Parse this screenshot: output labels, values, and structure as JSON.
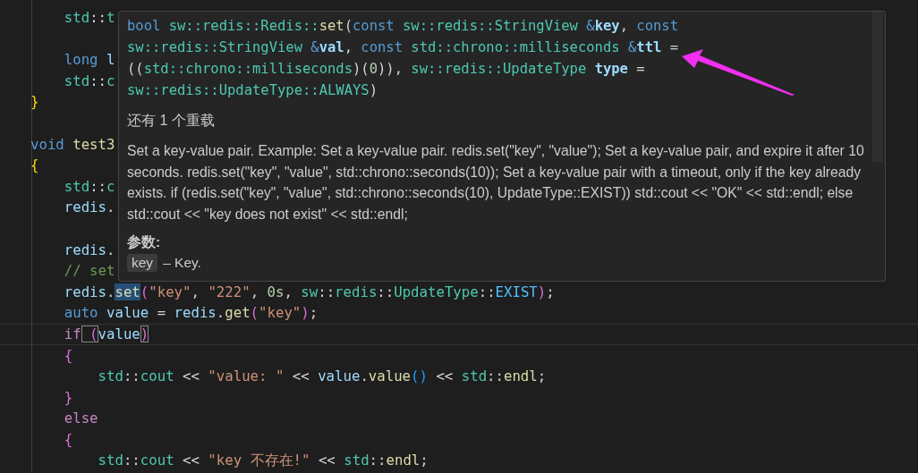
{
  "code_lines": [
    {
      "kind": "code",
      "tokens": [
        {
          "t": "    std",
          "kind": "type"
        },
        {
          "t": "::",
          "kind": "plain"
        },
        {
          "t": "t",
          "kind": "type"
        }
      ]
    },
    {
      "kind": "blank"
    },
    {
      "kind": "code",
      "tokens": [
        {
          "t": "    long",
          "kind": "kw"
        },
        {
          "t": " l",
          "kind": "var"
        }
      ]
    },
    {
      "kind": "code",
      "tokens": [
        {
          "t": "    std",
          "kind": "type"
        },
        {
          "t": "::",
          "kind": "plain"
        },
        {
          "t": "c",
          "kind": "type"
        }
      ]
    },
    {
      "kind": "code",
      "tokens": [
        {
          "t": "}",
          "kind": "brace1"
        }
      ]
    },
    {
      "kind": "blank"
    },
    {
      "kind": "code",
      "tokens": [
        {
          "t": "void",
          "kind": "kw"
        },
        {
          "t": " test3",
          "kind": "fn"
        }
      ]
    },
    {
      "kind": "code",
      "tokens": [
        {
          "t": "{",
          "kind": "brace1"
        }
      ]
    },
    {
      "kind": "code",
      "tokens": [
        {
          "t": "    std",
          "kind": "type"
        },
        {
          "t": "::",
          "kind": "plain"
        },
        {
          "t": "c",
          "kind": "type"
        }
      ]
    },
    {
      "kind": "code",
      "tokens": [
        {
          "t": "    redis",
          "kind": "var"
        },
        {
          "t": ".",
          "kind": "plain"
        }
      ]
    },
    {
      "kind": "blank"
    },
    {
      "kind": "code",
      "tokens": [
        {
          "t": "    redis",
          "kind": "var"
        },
        {
          "t": ".",
          "kind": "plain"
        }
      ]
    },
    {
      "kind": "code",
      "tokens": [
        {
          "t": "    // set",
          "kind": "comment"
        }
      ]
    },
    {
      "kind": "code",
      "tokens": [
        {
          "t": "    redis",
          "kind": "var"
        },
        {
          "t": ".",
          "kind": "plain"
        },
        {
          "t": "set",
          "kind": "fn",
          "highlighted": true
        },
        {
          "t": "(",
          "kind": "brace2"
        },
        {
          "t": "\"key\"",
          "kind": "str"
        },
        {
          "t": ",",
          "kind": "plain"
        },
        {
          "t": " \"222\"",
          "kind": "str"
        },
        {
          "t": ",",
          "kind": "plain"
        },
        {
          "t": " 0s",
          "kind": "num"
        },
        {
          "t": ",",
          "kind": "plain"
        },
        {
          "t": " sw",
          "kind": "type"
        },
        {
          "t": "::",
          "kind": "plain"
        },
        {
          "t": "redis",
          "kind": "type"
        },
        {
          "t": "::",
          "kind": "plain"
        },
        {
          "t": "UpdateType",
          "kind": "type"
        },
        {
          "t": "::",
          "kind": "plain"
        },
        {
          "t": "EXIST",
          "kind": "enum"
        },
        {
          "t": ")",
          "kind": "brace2"
        },
        {
          "t": ";",
          "kind": "plain"
        }
      ]
    },
    {
      "kind": "code",
      "tokens": [
        {
          "t": "    auto",
          "kind": "kw"
        },
        {
          "t": " value",
          "kind": "var"
        },
        {
          "t": " =",
          "kind": "plain"
        },
        {
          "t": " redis",
          "kind": "var"
        },
        {
          "t": ".",
          "kind": "plain"
        },
        {
          "t": "get",
          "kind": "fn"
        },
        {
          "t": "(",
          "kind": "brace2"
        },
        {
          "t": "\"key\"",
          "kind": "str"
        },
        {
          "t": ")",
          "kind": "brace2"
        },
        {
          "t": ";",
          "kind": "plain"
        }
      ]
    },
    {
      "kind": "code",
      "current": true,
      "tokens": [
        {
          "t": "    if",
          "kind": "ctrl"
        },
        {
          "t": " (",
          "kind": "brace2",
          "matched": true
        },
        {
          "t": "value",
          "kind": "var"
        },
        {
          "t": ")",
          "kind": "brace2",
          "matched": true
        }
      ]
    },
    {
      "kind": "code",
      "tokens": [
        {
          "t": "    {",
          "kind": "brace2"
        }
      ]
    },
    {
      "kind": "code",
      "tokens": [
        {
          "t": "        std",
          "kind": "type"
        },
        {
          "t": "::",
          "kind": "plain"
        },
        {
          "t": "cout",
          "kind": "type"
        },
        {
          "t": " <<",
          "kind": "plain"
        },
        {
          "t": " \"value: \"",
          "kind": "str"
        },
        {
          "t": " <<",
          "kind": "plain"
        },
        {
          "t": " value",
          "kind": "var"
        },
        {
          "t": ".",
          "kind": "plain"
        },
        {
          "t": "value",
          "kind": "fn"
        },
        {
          "t": "()",
          "kind": "brace3"
        },
        {
          "t": " <<",
          "kind": "plain"
        },
        {
          "t": " std",
          "kind": "type"
        },
        {
          "t": "::",
          "kind": "plain"
        },
        {
          "t": "endl",
          "kind": "fn"
        },
        {
          "t": ";",
          "kind": "plain"
        }
      ]
    },
    {
      "kind": "code",
      "tokens": [
        {
          "t": "    }",
          "kind": "brace2"
        }
      ]
    },
    {
      "kind": "code",
      "tokens": [
        {
          "t": "    else",
          "kind": "ctrl"
        }
      ]
    },
    {
      "kind": "code",
      "tokens": [
        {
          "t": "    {",
          "kind": "brace2"
        }
      ]
    },
    {
      "kind": "code",
      "tokens": [
        {
          "t": "        std",
          "kind": "type"
        },
        {
          "t": "::",
          "kind": "plain"
        },
        {
          "t": "cout",
          "kind": "type"
        },
        {
          "t": " <<",
          "kind": "plain"
        },
        {
          "t": " \"key 不存在!\"",
          "kind": "str"
        },
        {
          "t": " <<",
          "kind": "plain"
        },
        {
          "t": " std",
          "kind": "type"
        },
        {
          "t": "::",
          "kind": "plain"
        },
        {
          "t": "endl",
          "kind": "fn"
        },
        {
          "t": ";",
          "kind": "plain"
        }
      ]
    }
  ],
  "hover": {
    "signature_lines": [
      [
        {
          "t": "bool",
          "kind": "kw"
        },
        {
          "t": " sw::redis::Redis::",
          "kind": "type"
        },
        {
          "t": "set",
          "kind": "fn"
        },
        {
          "t": "(",
          "kind": "plain"
        },
        {
          "t": "const",
          "kind": "kw"
        },
        {
          "t": " sw::redis::StringView",
          "kind": "type"
        },
        {
          "t": " &",
          "kind": "kw"
        },
        {
          "t": "key",
          "kind": "param"
        },
        {
          "t": ",",
          "kind": "plain"
        },
        {
          "t": " const",
          "kind": "kw"
        }
      ],
      [
        {
          "t": "sw::redis::StringView",
          "kind": "type"
        },
        {
          "t": " &",
          "kind": "kw"
        },
        {
          "t": "val",
          "kind": "param"
        },
        {
          "t": ",",
          "kind": "plain"
        },
        {
          "t": " const",
          "kind": "kw"
        },
        {
          "t": " std::chrono::milliseconds",
          "kind": "type"
        },
        {
          "t": " &",
          "kind": "kw"
        },
        {
          "t": "ttl",
          "kind": "param"
        },
        {
          "t": " =",
          "kind": "plain"
        }
      ],
      [
        {
          "t": "((",
          "kind": "plain"
        },
        {
          "t": "std::chrono::milliseconds",
          "kind": "type"
        },
        {
          "t": ")(",
          "kind": "plain"
        },
        {
          "t": "0",
          "kind": "num"
        },
        {
          "t": ")),",
          "kind": "plain"
        },
        {
          "t": " sw::redis::UpdateType",
          "kind": "type"
        },
        {
          "t": " type",
          "kind": "param"
        },
        {
          "t": " =",
          "kind": "plain"
        }
      ],
      [
        {
          "t": "sw::redis::UpdateType::ALWAYS",
          "kind": "type"
        },
        {
          "t": ")",
          "kind": "plain"
        }
      ]
    ],
    "overloads": "还有 1 个重载",
    "description": "Set a key-value pair. Example: Set a key-value pair. redis.set(\"key\", \"value\"); Set a key-value pair, and expire it after 10 seconds. redis.set(\"key\", \"value\", std::chrono::seconds(10)); Set a key-value pair with a timeout, only if the key already exists. if (redis.set(\"key\", \"value\", std::chrono::seconds(10), UpdateType::EXIST)) std::cout << \"OK\" << std::endl; else std::cout << \"key does not exist\" << std::endl;",
    "params_heading": "参数:",
    "params": [
      {
        "name": "key",
        "desc": "– Key."
      }
    ]
  }
}
